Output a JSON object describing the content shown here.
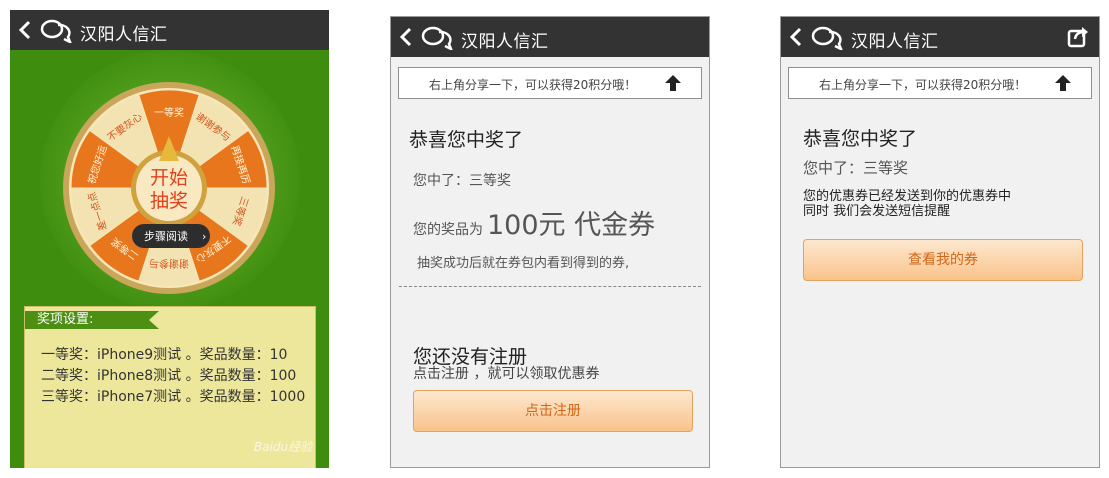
{
  "app": {
    "title": "汉阳人信汇"
  },
  "lottery": {
    "segments": [
      "一等奖",
      "谢谢参与",
      "再接再厉",
      "三等奖",
      "不要灰心",
      "谢谢参与",
      "二等奖",
      "差一点点",
      "祝您好运",
      "不要灰心"
    ],
    "center_label_line1": "开始",
    "center_label_line2": "抽奖",
    "step_label": "步骤阅读",
    "prize_settings_title": "奖项设置:",
    "prizes": [
      "一等奖：iPhone9测试 。奖品数量：10",
      "二等奖：iPhone8测试 。奖品数量：100",
      "三等奖：iPhone7测试 。奖品数量：1000"
    ],
    "watermark": "Baidu经验"
  },
  "result": {
    "share_tip": "右上角分享一下，可以获得20积分哦！",
    "congrats": "恭喜您中奖了",
    "won_line": "您中了：三等奖",
    "prize_label": "您的奖品为",
    "prize_amount": "100元 代金券",
    "info": "抽奖成功后就在券包内看到得到的券,",
    "not_registered": "您还没有注册",
    "register_hint": "点击注册 ，就可以领取优惠券",
    "register_button": "点击注册"
  },
  "coupon": {
    "share_tip": "右上角分享一下，可以获得20积分哦！",
    "congrats": "恭喜您中奖了",
    "won_line": "您中了：三等奖",
    "sent_line1": "您的优惠券已经发送到你的优惠券中",
    "sent_line2": "同时 我们会发送短信提醒",
    "view_button": "查看我的券"
  },
  "colors": {
    "header": "#333333",
    "green": "#3f8d0f",
    "orange": "#e8761c",
    "cream": "#f3e3b3"
  },
  "icons": [
    "back-chevron-icon",
    "chat-bubbles-icon",
    "share-icon",
    "arrow-up-icon"
  ]
}
